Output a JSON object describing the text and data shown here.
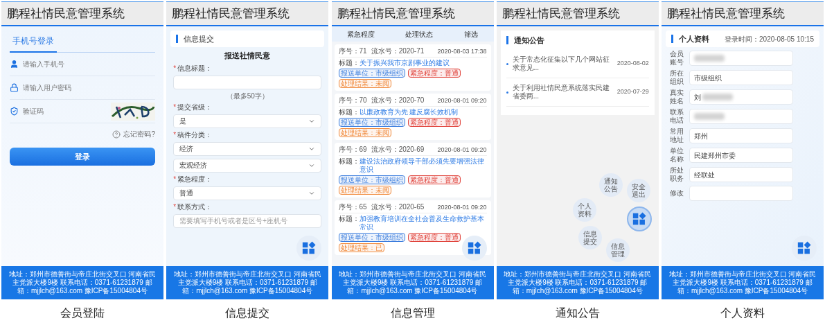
{
  "screens": [
    {
      "kind": "login",
      "title": "鹏程社情民意管理系统",
      "tabs": [
        {
          "label": "手机号登录",
          "selected": true
        }
      ],
      "fields": [
        {
          "kind": "phone",
          "placeholder": "请输入手机号"
        },
        {
          "kind": "password",
          "placeholder": "请输入用户密码"
        },
        {
          "kind": "captcha",
          "placeholder": "验证码"
        }
      ],
      "forgot": "忘记密码?",
      "submit": "登录",
      "footer": "地址：郑州市德善街与帝庄北街交叉口 河南省民主党派大楼9楼 联系电话：0371-61231879 邮箱：mjjlch@163.com 豫ICP备15004804号",
      "caption": "会员登陆"
    },
    {
      "kind": "submit",
      "title": "鹏程社情民意管理系统",
      "section": "信息提交",
      "heading": "报送社情民意",
      "fields": [
        {
          "kind": "text",
          "mark": "*",
          "label": "信息标题：",
          "hint": "（最多50字）"
        },
        {
          "kind": "select",
          "mark": "*",
          "label": "提交省级：",
          "values": [
            "是"
          ]
        },
        {
          "kind": "select",
          "mark": "*",
          "label": "稿件分类：",
          "values": [
            "经济",
            "宏观经济"
          ]
        },
        {
          "kind": "select",
          "mark": "*",
          "label": "紧急程度：",
          "values": [
            "普通"
          ]
        },
        {
          "kind": "text",
          "mark": "*",
          "label": "联系方式：",
          "placeholder": "需要填写手机号或者是区号+座机号"
        }
      ],
      "float_menu": {
        "expanded": false
      },
      "footer": "地址：郑州市德善街与帝庄北街交叉口 河南省民主党派大楼9楼 联系电话：0371-61231879 邮箱：mjjlch@163.com 豫ICP备15004804号",
      "caption": "信息提交"
    },
    {
      "kind": "manage",
      "title": "鹏程社情民意管理系统",
      "filters": [
        "紧急程度",
        "处理状态",
        "筛选"
      ],
      "records": [
        {
          "seq": "序号：71",
          "serial": "流水号：2020-71",
          "date": "2020-08-03 17:38",
          "title_label": "标题：",
          "title": "关于振兴我市京剧事业的建议",
          "tags": [
            {
              "text": "报送单位：市级组织",
              "color": "#3b7ddd"
            },
            {
              "text": "紧急程度：普通",
              "color": "#e0433b"
            },
            {
              "text": "处理结果：未阅",
              "color": "#f08a3c"
            }
          ]
        },
        {
          "seq": "序号：70",
          "serial": "流水号：2020-70",
          "date": "2020-08-01 09:20",
          "title_label": "标题：",
          "title": "以廉政教育为先 建反腐长效机制",
          "tags": [
            {
              "text": "报送单位：市级组织",
              "color": "#3b7ddd"
            },
            {
              "text": "紧急程度：普通",
              "color": "#e0433b"
            },
            {
              "text": "处理结果：未阅",
              "color": "#f08a3c"
            }
          ]
        },
        {
          "seq": "序号：69",
          "serial": "流水号：2020-69",
          "date": "2020-08-01 09:20",
          "title_label": "标题：",
          "title": "建设法治政府领导干部必须先要增强法律意识",
          "tags": [
            {
              "text": "报送单位：市级组织",
              "color": "#3b7ddd"
            },
            {
              "text": "紧急程度：普通",
              "color": "#e0433b"
            },
            {
              "text": "处理结果：未阅",
              "color": "#f08a3c"
            }
          ]
        },
        {
          "seq": "序号：65",
          "serial": "流水号：2020-65",
          "date": "2020-08-01 09:20",
          "title_label": "标题：",
          "title": "加强教育培训在全社会普及生命救护基本常识",
          "tags": [
            {
              "text": "报送单位：市级组织",
              "color": "#3b7ddd"
            },
            {
              "text": "紧急程度：普通",
              "color": "#e0433b"
            },
            {
              "text": "处理结果：已",
              "color": "#f08a3c"
            }
          ]
        }
      ],
      "float_menu": {
        "expanded": false
      },
      "footer": "地址：郑州市德善街与帝庄北街交叉口 河南省民主党派大楼9楼 联系电话：0371-61231879 邮箱：mjjlch@163.com 豫ICP备15004804号",
      "caption": "信息管理"
    },
    {
      "kind": "notices",
      "title": "鹏程社情民意管理系统",
      "section": "通知公告",
      "notices": [
        {
          "text": "关于常态化征集以下几个网站征求意见...",
          "date": "2020-08-02"
        },
        {
          "text": "关于利用社情民意系统落实民建省委两...",
          "date": "2020-07-29"
        }
      ],
      "float_menu": {
        "expanded": true,
        "items": [
          "安全退出",
          "通知公告",
          "个人资料",
          "信息提交",
          "信息管理"
        ]
      },
      "footer": "地址：郑州市德善街与帝庄北街交叉口 河南省民主党派大楼9楼 联系电话：0371-61231879 邮箱：mjjlch@163.com 豫ICP备15004804号",
      "caption": "通知公告"
    },
    {
      "kind": "profile",
      "title": "鹏程社情民意管理系统",
      "section": "个人资料",
      "login_time": "登录时间：2020-08-05 10:15",
      "fields": [
        {
          "label": "会员账号",
          "blurred": true
        },
        {
          "label": "所在组织",
          "value": "市级组织",
          "blurred": false
        },
        {
          "label": "真实姓名",
          "value": "刘",
          "blurred": true
        },
        {
          "label": "联系电话",
          "blurred": true
        },
        {
          "label": "常用地址",
          "value": "郑州",
          "blurred": false
        },
        {
          "label": "单位名称",
          "value": "民建郑州市委",
          "blurred": false
        },
        {
          "label": "所处职务",
          "value": "经联处",
          "blurred": false
        },
        {
          "label": "修改",
          "blurred": false
        }
      ],
      "float_menu": {
        "expanded": false
      },
      "footer": "地址：郑州市德善街与帝庄北街交叉口 河南省民主党派大楼9楼 联系电话：0371-61231879 邮箱：mjjlch@163.com 豫ICP备15004804号",
      "caption": "个人资料"
    }
  ]
}
